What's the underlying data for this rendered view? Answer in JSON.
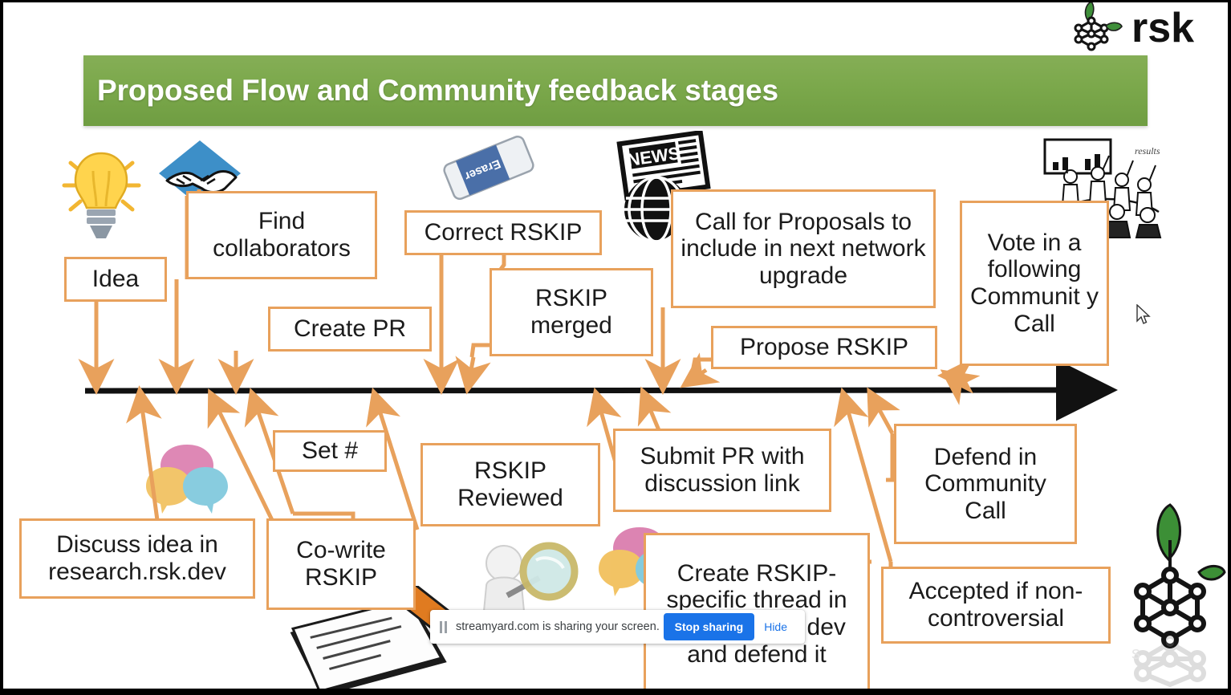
{
  "slide": {
    "title": "Proposed Flow and Community feedback stages",
    "brand_name": "rsk",
    "banner_color": "#7ba84b",
    "box_border_color": "#e8a15c",
    "arrow_color": "#e8a15c",
    "timeline_color": "#000000"
  },
  "above_boxes": [
    {
      "id": "idea",
      "label": "Idea"
    },
    {
      "id": "find-collaborators",
      "label": "Find collaborators"
    },
    {
      "id": "create-pr",
      "label": "Create PR"
    },
    {
      "id": "correct-rskip",
      "label": "Correct RSKIP"
    },
    {
      "id": "rskip-merged",
      "label": "RSKIP merged"
    },
    {
      "id": "call-for-proposals",
      "label": "Call for Proposals to include in next network upgrade"
    },
    {
      "id": "propose-rskip",
      "label": "Propose RSKIP"
    },
    {
      "id": "vote-community-call",
      "label": "Vote in a following Communit y Call"
    }
  ],
  "below_boxes": [
    {
      "id": "discuss-idea",
      "label": "Discuss idea in research.rsk.dev"
    },
    {
      "id": "set-hash",
      "label": "Set #"
    },
    {
      "id": "co-write-rskip",
      "label": "Co-write RSKIP"
    },
    {
      "id": "rskip-reviewed",
      "label": "RSKIP Reviewed"
    },
    {
      "id": "submit-pr",
      "label": "Submit PR with discussion link"
    },
    {
      "id": "create-thread",
      "label": "Create RSKIP-specific thread in research.rsk.dev and defend it"
    },
    {
      "id": "defend-community",
      "label": "Defend in Community Call"
    },
    {
      "id": "accepted",
      "label": "Accepted if non-controversial"
    }
  ],
  "clipart": [
    {
      "id": "lightbulb-icon",
      "name": "lightbulb-icon"
    },
    {
      "id": "handshake-icon",
      "name": "handshake-icon"
    },
    {
      "id": "eraser-icon",
      "name": "eraser-icon",
      "label": "Eraser"
    },
    {
      "id": "news-globe-icon",
      "name": "news-globe-icon",
      "label": "NEWS"
    },
    {
      "id": "meeting-icon",
      "name": "community-meeting-icon"
    },
    {
      "id": "speech-bubbles-icon",
      "name": "speech-bubbles-icon"
    },
    {
      "id": "pencil-paper-icon",
      "name": "pencil-writing-icon"
    },
    {
      "id": "magnifier-icon",
      "name": "magnifying-glass-review-icon"
    },
    {
      "id": "speech-bubbles-icon-2",
      "name": "speech-bubbles-icon"
    }
  ],
  "share_bar": {
    "message": "streamyard.com is sharing your screen.",
    "stop_label": "Stop sharing",
    "hide_label": "Hide",
    "accent_color": "#1a73e8"
  }
}
